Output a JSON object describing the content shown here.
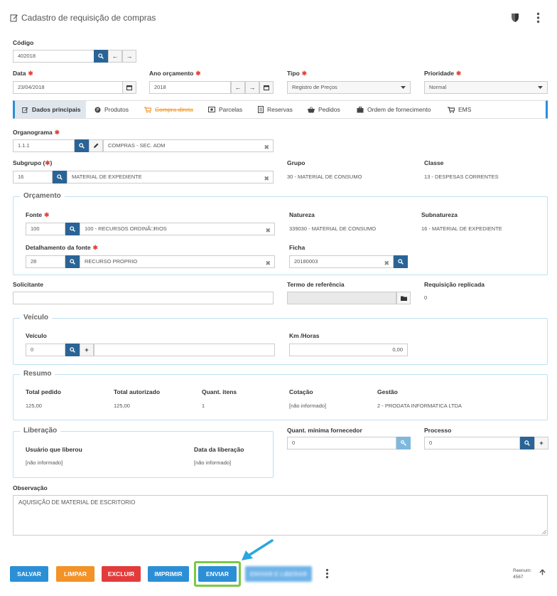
{
  "header": {
    "title": "Cadastro de requisição de compras"
  },
  "codigo": {
    "label": "Código",
    "value": "402018"
  },
  "data": {
    "label": "Data",
    "value": "23/04/2018"
  },
  "ano": {
    "label": "Ano orçamento",
    "value": "2018"
  },
  "tipo": {
    "label": "Tipo",
    "value": "Registro de Preços"
  },
  "prioridade": {
    "label": "Prioridade",
    "value": "Normal"
  },
  "tabs": [
    {
      "label": "Dados principais"
    },
    {
      "label": "Produtos"
    },
    {
      "label": "Compra direta"
    },
    {
      "label": "Parcelas"
    },
    {
      "label": "Reservas"
    },
    {
      "label": "Pedidos"
    },
    {
      "label": "Ordem de fornecimento"
    },
    {
      "label": "EMS"
    }
  ],
  "organograma": {
    "label": "Organograma",
    "code": "1.1.1",
    "desc": "COMPRAS - SEC. ADM"
  },
  "subgrupo": {
    "label": "Subgrupo (",
    "label_end": ")",
    "code": "16",
    "desc": "MATERIAL DE EXPEDIENTE"
  },
  "grupo": {
    "label": "Grupo",
    "value": "30 - MATERIAL DE CONSUMO"
  },
  "classe": {
    "label": "Classe",
    "value": "13 - DESPESAS CORRENTES"
  },
  "orcamento": {
    "legend": "Orçamento",
    "fonte": {
      "label": "Fonte",
      "code": "100",
      "desc": "100 - RECURSOS ORDINÃ□RIOS"
    },
    "natureza": {
      "label": "Natureza",
      "value": "339030 - MATERIAL DE CONSUMO"
    },
    "subnatureza": {
      "label": "Subnatureza",
      "value": "16 - MATERIAL DE EXPEDIENTE"
    },
    "detalhamento": {
      "label": "Detalhamento da fonte",
      "code": "28",
      "desc": "RECURSO PROPRIO"
    },
    "ficha": {
      "label": "Ficha",
      "value": "20180003"
    }
  },
  "solicitante": {
    "label": "Solicitante",
    "value": ""
  },
  "termo": {
    "label": "Termo de referência"
  },
  "replicada": {
    "label": "Requisição replicada",
    "value": "0"
  },
  "veiculo": {
    "legend": "Veículo",
    "label": "Veículo",
    "value": "0",
    "km_label": "Km /Horas",
    "km_value": "0,00"
  },
  "resumo": {
    "legend": "Resumo",
    "total_pedido": {
      "label": "Total pedido",
      "value": "125,00"
    },
    "total_autorizado": {
      "label": "Total autorizado",
      "value": "125,00"
    },
    "quant_itens": {
      "label": "Quant. itens",
      "value": "1"
    },
    "cotacao": {
      "label": "Cotação",
      "value": "[não informado]"
    },
    "gestao": {
      "label": "Gestão",
      "value": "2 - PRODATA INFORMATICA LTDA"
    }
  },
  "liberacao": {
    "legend": "Liberação",
    "usuario": {
      "label": "Usuário que liberou",
      "value": "[não informado]"
    },
    "data": {
      "label": "Data da liberação",
      "value": "[não informado]"
    }
  },
  "quant_min": {
    "label": "Quant. mínima fornecedor",
    "value": "0"
  },
  "processo": {
    "label": "Processo",
    "value": "0"
  },
  "observacao": {
    "label": "Observação",
    "value": "AQUISIÇÃO DE MATERIAL DE ESCRITORIO"
  },
  "buttons": {
    "salvar": "SALVAR",
    "limpar": "LIMPAR",
    "excluir": "EXCLUIR",
    "imprimir": "IMPRIMIR",
    "enviar": "ENVIAR",
    "enviar_liberar": "ENVIAR E LIBERAR"
  },
  "footer": {
    "reenum_label": "Reenum:",
    "reenum_value": "4567"
  },
  "colors": {
    "primary": "#2a6496",
    "required": "#e0433b",
    "salvar": "#2b8fd6",
    "limpar": "#f29227",
    "excluir": "#e33b3b",
    "enviar_highlight": "#7ac943",
    "arrow": "#2aa6e0"
  }
}
